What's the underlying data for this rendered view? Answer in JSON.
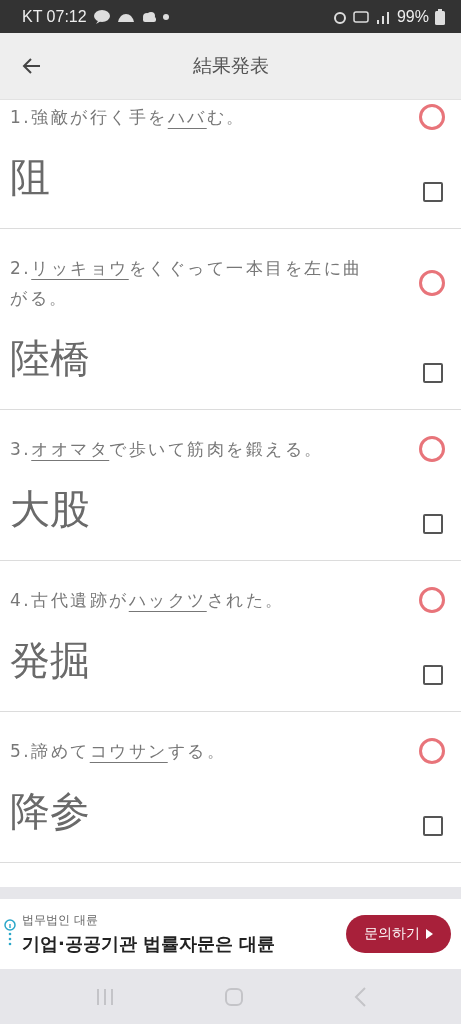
{
  "status_bar": {
    "carrier_time": "KT 07:12",
    "battery": "99%"
  },
  "header": {
    "title": "結果発表"
  },
  "questions": [
    {
      "before": "1.強敵が行く手を",
      "underlined": "ハバ",
      "after": "む。",
      "answer": "阻",
      "kind": "correct",
      "checked": false
    },
    {
      "before": "2.",
      "underlined": "リッキョウ",
      "after": "をくぐって一本目を左に曲がる。",
      "answer": "陸橋",
      "kind": "correct",
      "checked": false
    },
    {
      "before": "3.",
      "underlined": "オオマタ",
      "after": "で歩いて筋肉を鍛える。",
      "answer": "大股",
      "kind": "correct",
      "checked": false
    },
    {
      "before": "4.古代遺跡が",
      "underlined": "ハックツ",
      "after": "された。",
      "answer": "発掘",
      "kind": "correct",
      "checked": false
    },
    {
      "before": "5.諦めて",
      "underlined": "コウサン",
      "after": "する。",
      "answer": "降参",
      "kind": "correct",
      "checked": false
    }
  ],
  "ad": {
    "advertiser": "법무법인 대륜",
    "headline": "기업·공공기관 법률자문은 대륜",
    "button": "문의하기"
  }
}
